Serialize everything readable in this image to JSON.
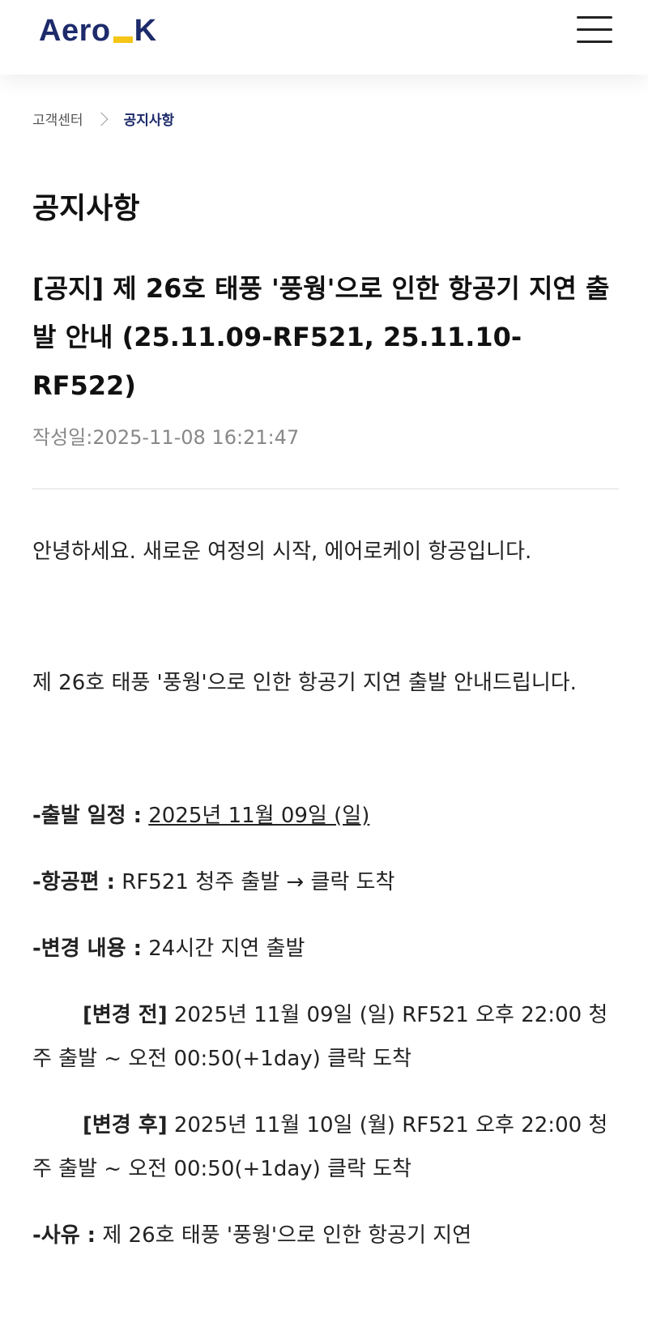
{
  "header": {
    "logo_left": "Aero",
    "logo_right": "K"
  },
  "breadcrumb": {
    "parent": "고객센터",
    "current": "공지사항"
  },
  "page": {
    "title": "공지사항"
  },
  "notice": {
    "title": "[공지] 제 26호 태풍 '풍웡'으로 인한 항공기 지연 출발 안내 (25.11.09-RF521, 25.11.10-RF522)",
    "date_label": "작성일:",
    "date": "2025-11-08 16:21:47",
    "greeting": "안녕하세요. 새로운 여정의 시작, 에어로케이 항공입니다.",
    "intro": "제 26호 태풍 '풍웡'으로 인한 항공기 지연 출발 안내드립니다.",
    "schedule_label": "-출발 일정 :",
    "schedule_value": "2025년 11월 09일 (일)",
    "flight_label": "-항공편 :",
    "flight_value": "RF521 청주 출발 → 클락 도착",
    "change_label": "-변경 내용 :",
    "change_value": "24시간 지연 출발",
    "before_label": "[변경 전]",
    "before_value": "2025년 11월 09일 (일) RF521 오후 22:00 청주 출발 ~ 오전 00:50(+1day) 클락 도착",
    "after_label": "[변경 후]",
    "after_value": "2025년 11월 10일 (월) RF521 오후 22:00 청주 출발 ~ 오전 00:50(+1day) 클락 도착",
    "reason_label": "-사유 :",
    "reason_value": "제 26호 태풍 '풍웡'으로 인한 항공기 지연"
  },
  "colors": {
    "brand_navy": "#1d2b6b",
    "brand_yellow": "#f5c518",
    "muted_text": "#888888"
  }
}
